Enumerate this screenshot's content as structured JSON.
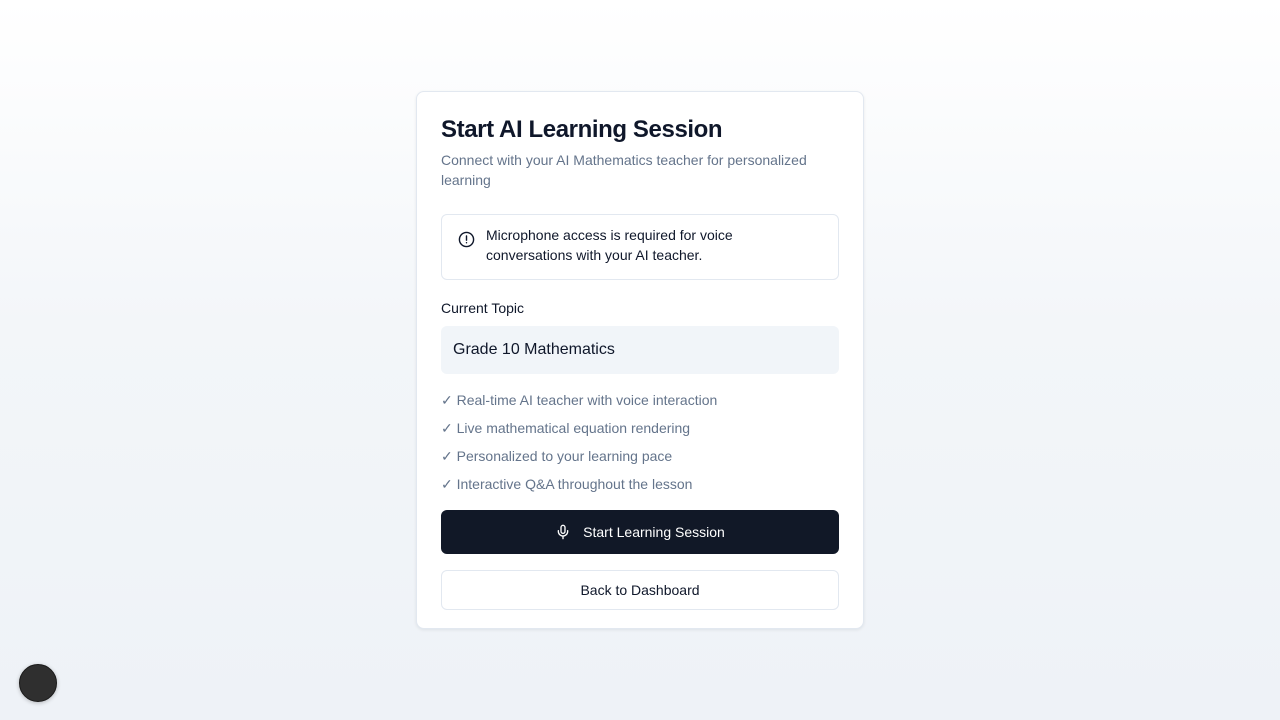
{
  "card": {
    "title": "Start AI Learning Session",
    "subtitle": "Connect with your AI Mathematics teacher for personalized learning"
  },
  "alert": {
    "icon": "alert-circle-icon",
    "text": "Microphone access is required for voice conversations with your AI teacher."
  },
  "topic": {
    "label": "Current Topic",
    "value": "Grade 10 Mathematics"
  },
  "features": [
    "✓ Real-time AI teacher with voice interaction",
    "✓ Live mathematical equation rendering",
    "✓ Personalized to your learning pace",
    "✓ Interactive Q&A throughout the lesson"
  ],
  "buttons": {
    "start_icon": "microphone-icon",
    "start_label": "Start Learning Session",
    "back_label": "Back to Dashboard"
  },
  "colors": {
    "primary": "#111827",
    "muted_text": "#64748b",
    "border": "#e2e8f0",
    "topic_bg": "#f1f5f9"
  }
}
